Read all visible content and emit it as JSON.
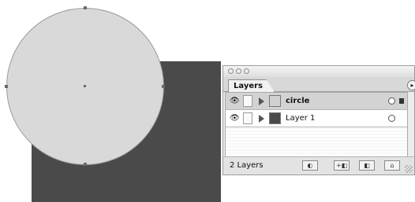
{
  "palette": {
    "tab_label": "Layers",
    "menu_glyph": "▸",
    "layers": [
      {
        "name": "circle",
        "thumb_color": "#d2d2d2",
        "selected": true
      },
      {
        "name": "Layer 1",
        "thumb_color": "#4a4a4a",
        "selected": false
      }
    ],
    "layer_count_text": "2 Layers",
    "icons": {
      "visibility": "eye-icon",
      "expand": "disclosure-triangle-icon",
      "target": "target-circle-icon",
      "selection": "selection-square-icon",
      "make_clipping_mask": "clipping-mask-icon",
      "new_sublayer": "new-sublayer-icon",
      "new_layer": "new-layer-icon",
      "delete": "trash-icon"
    },
    "button_glyphs": {
      "make_clipping_mask": "◐",
      "new_sublayer": "+◧",
      "new_layer": "◧",
      "delete": "⌂"
    },
    "eye_glyph": "👁"
  },
  "colors": {
    "canvas_background": "#ffffff",
    "rectangle_fill": "#4a4a4a",
    "circle_fill": "#d9d9d9"
  }
}
